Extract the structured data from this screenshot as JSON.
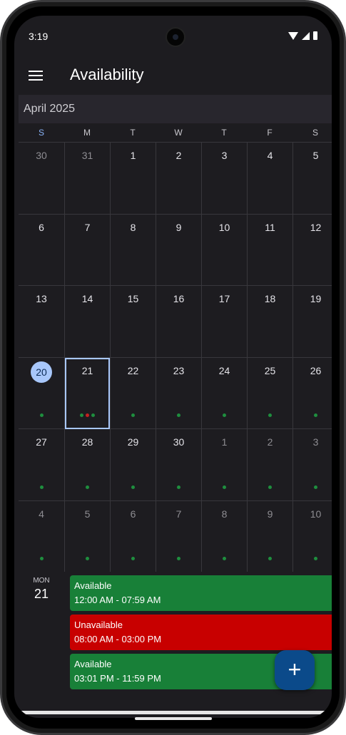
{
  "status_bar": {
    "time": "3:19"
  },
  "app_bar": {
    "title": "Availability"
  },
  "calendar": {
    "month_label": "April 2025",
    "weekdays": [
      "S",
      "M",
      "T",
      "W",
      "T",
      "F",
      "S"
    ],
    "weeks": [
      [
        {
          "n": "30",
          "other": true
        },
        {
          "n": "31",
          "other": true
        },
        {
          "n": "1"
        },
        {
          "n": "2"
        },
        {
          "n": "3"
        },
        {
          "n": "4"
        },
        {
          "n": "5"
        }
      ],
      [
        {
          "n": "6"
        },
        {
          "n": "7"
        },
        {
          "n": "8"
        },
        {
          "n": "9"
        },
        {
          "n": "10"
        },
        {
          "n": "11"
        },
        {
          "n": "12"
        }
      ],
      [
        {
          "n": "13"
        },
        {
          "n": "14"
        },
        {
          "n": "15"
        },
        {
          "n": "16"
        },
        {
          "n": "17"
        },
        {
          "n": "18"
        },
        {
          "n": "19"
        }
      ],
      [
        {
          "n": "20",
          "today": true,
          "dots": [
            "green"
          ]
        },
        {
          "n": "21",
          "selected": true,
          "dots": [
            "green",
            "red",
            "green"
          ]
        },
        {
          "n": "22",
          "dots": [
            "green"
          ]
        },
        {
          "n": "23",
          "dots": [
            "green"
          ]
        },
        {
          "n": "24",
          "dots": [
            "green"
          ]
        },
        {
          "n": "25",
          "dots": [
            "green"
          ]
        },
        {
          "n": "26",
          "dots": [
            "green"
          ]
        }
      ],
      [
        {
          "n": "27",
          "dots": [
            "green"
          ]
        },
        {
          "n": "28",
          "dots": [
            "green"
          ]
        },
        {
          "n": "29",
          "dots": [
            "green"
          ]
        },
        {
          "n": "30",
          "dots": [
            "green"
          ]
        },
        {
          "n": "1",
          "other": true,
          "dots": [
            "green"
          ]
        },
        {
          "n": "2",
          "other": true,
          "dots": [
            "green"
          ]
        },
        {
          "n": "3",
          "other": true,
          "dots": [
            "green"
          ]
        }
      ],
      [
        {
          "n": "4",
          "other": true,
          "dots": [
            "green"
          ]
        },
        {
          "n": "5",
          "other": true,
          "dots": [
            "green"
          ]
        },
        {
          "n": "6",
          "other": true,
          "dots": [
            "green"
          ]
        },
        {
          "n": "7",
          "other": true,
          "dots": [
            "green"
          ]
        },
        {
          "n": "8",
          "other": true,
          "dots": [
            "green"
          ]
        },
        {
          "n": "9",
          "other": true,
          "dots": [
            "green"
          ]
        },
        {
          "n": "10",
          "other": true,
          "dots": [
            "green"
          ]
        }
      ]
    ]
  },
  "agenda": {
    "day_of_week": "MON",
    "day_number": "21",
    "events": [
      {
        "title": "Available",
        "time": "12:00 AM - 07:59 AM",
        "status": "available"
      },
      {
        "title": "Unavailable",
        "time": "08:00 AM - 03:00 PM",
        "status": "unavailable"
      },
      {
        "title": "Available",
        "time": "03:01 PM - 11:59 PM",
        "status": "available"
      }
    ]
  },
  "fab": {
    "icon": "add-icon",
    "symbol": "+"
  },
  "colors": {
    "available": "#188038",
    "unavailable": "#c80000",
    "dot_green": "#1e8e3e",
    "dot_red": "#c5221f",
    "accent": "#a8c7fa"
  }
}
